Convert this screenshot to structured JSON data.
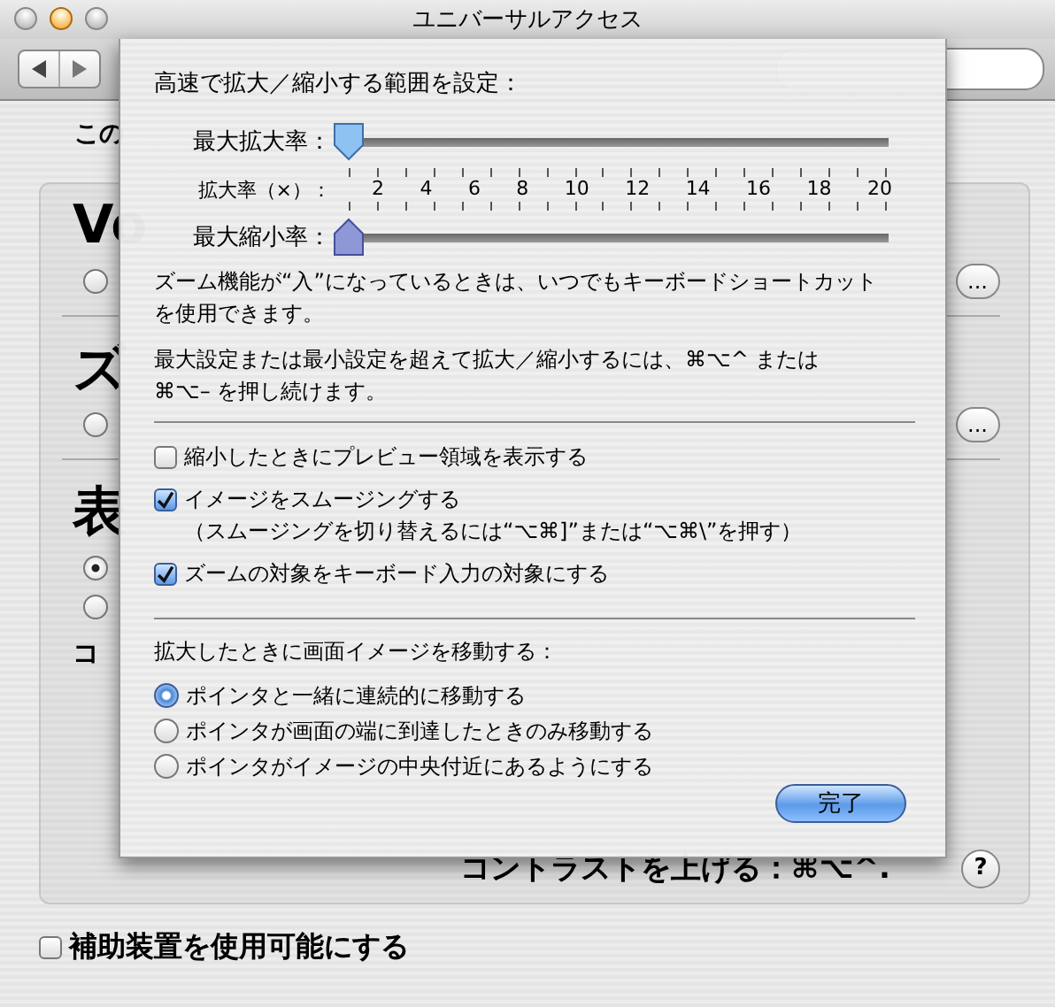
{
  "window": {
    "title": "ユニバーサルアクセス"
  },
  "background": {
    "intro": "この",
    "sections": [
      {
        "heading": "Vo",
        "radios": [
          {
            "selected": false
          }
        ],
        "button": "..."
      },
      {
        "heading": "ズ",
        "radios": [
          {
            "selected": false
          }
        ],
        "button": "..."
      },
      {
        "heading": "表",
        "radios": [
          {
            "selected": true
          },
          {
            "selected": false
          }
        ],
        "subheading": "コ"
      }
    ],
    "contrast_shortcut": "コントラストを上げる：⌘⌥^.",
    "help": "?"
  },
  "assistive_devices": {
    "label": "補助装置を使用可能にする",
    "checked": false
  },
  "sheet": {
    "heading": "高速で拡大／縮小する範囲を設定：",
    "sliders": [
      {
        "label": "最大拡大率：",
        "level": 0,
        "kind": "downward"
      },
      {
        "label": "最大縮小率：",
        "level": 0,
        "kind": "upward"
      }
    ],
    "scale_label": "拡大率（×）：",
    "scale_ticks": [
      "2",
      "4",
      "6",
      "8",
      "10",
      "12",
      "14",
      "16",
      "18",
      "20"
    ],
    "notes": [
      "ズーム機能が“入”になっているときは、いつでもキーボードショートカットを使用できます。",
      "最大設定または最小設定を超えて拡大／縮小するには、⌘⌥^ または ⌘⌥– を押し続けます。"
    ],
    "checkboxes": [
      {
        "label": "縮小したときにプレビュー領域を表示する",
        "checked": false
      },
      {
        "label": "イメージをスムージングする",
        "sublabel": "（スムージングを切り替えるには“⌥⌘]”または“⌥⌘\\”を押す）",
        "checked": true
      },
      {
        "label": "ズームの対象をキーボード入力の対象にする",
        "checked": true
      }
    ],
    "move_heading": "拡大したときに画面イメージを移動する：",
    "move_options": [
      {
        "label": "ポインタと一緒に連続的に移動する",
        "selected": true
      },
      {
        "label": "ポインタが画面の端に到達したときのみ移動する",
        "selected": false
      },
      {
        "label": "ポインタがイメージの中央付近にあるようにする",
        "selected": false
      }
    ],
    "done_button": "完了"
  }
}
